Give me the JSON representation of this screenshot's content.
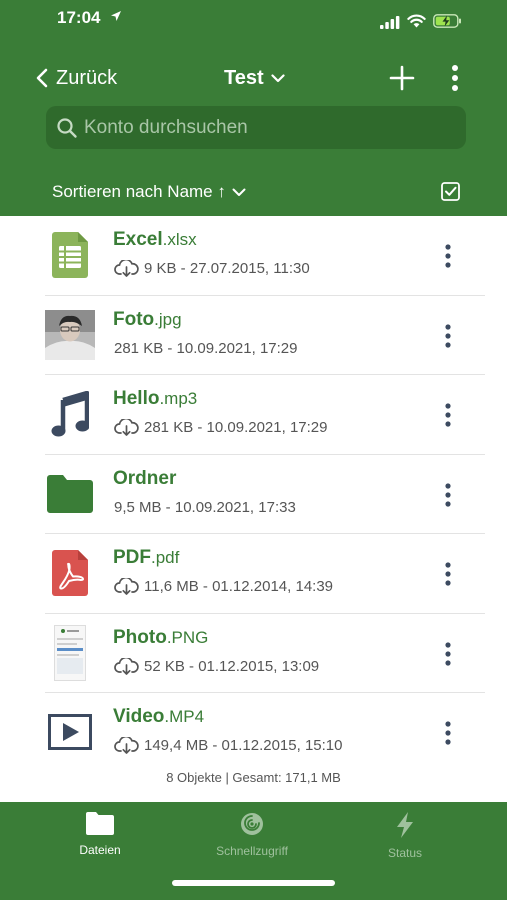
{
  "status_bar": {
    "time": "17:04"
  },
  "nav": {
    "back_label": "Zurück",
    "title": "Test"
  },
  "search": {
    "placeholder": "Konto durchsuchen"
  },
  "sort": {
    "label": "Sortieren nach Name ↑"
  },
  "files": [
    {
      "name": "Excel",
      "ext": ".xlsx",
      "meta": "9 KB - 27.07.2015, 11:30",
      "icon": "spreadsheet-icon",
      "cloud": true
    },
    {
      "name": "Foto",
      "ext": ".jpg",
      "meta": "281 KB - 10.09.2021, 17:29",
      "icon": "photo-thumbnail",
      "cloud": false
    },
    {
      "name": "Hello",
      "ext": ".mp3",
      "meta": "281 KB - 10.09.2021, 17:29",
      "icon": "music-note-icon",
      "cloud": true
    },
    {
      "name": "Ordner",
      "ext": "",
      "meta": "9,5 MB - 10.09.2021, 17:33",
      "icon": "folder-icon",
      "cloud": false
    },
    {
      "name": "PDF",
      "ext": ".pdf",
      "meta": "11,6 MB - 01.12.2014, 14:39",
      "icon": "pdf-icon",
      "cloud": true
    },
    {
      "name": "Photo",
      "ext": ".PNG",
      "meta": "52 KB - 01.12.2015, 13:09",
      "icon": "screenshot-thumbnail",
      "cloud": true
    },
    {
      "name": "Video",
      "ext": ".MP4",
      "meta": "149,4 MB - 01.12.2015, 15:10",
      "icon": "video-play-icon",
      "cloud": true
    }
  ],
  "summary": "8 Objekte | Gesamt: 171,1 MB",
  "tabs": [
    {
      "label": "Dateien",
      "icon": "folder-icon",
      "active": true
    },
    {
      "label": "Schnellzugriff",
      "icon": "quick-access-icon",
      "active": false
    },
    {
      "label": "Status",
      "icon": "lightning-icon",
      "active": false
    }
  ],
  "colors": {
    "brand_green": "#3a7d37",
    "search_bg": "#2f6a2c",
    "text_gray": "#555555",
    "icon_navy": "#3c4a60"
  }
}
